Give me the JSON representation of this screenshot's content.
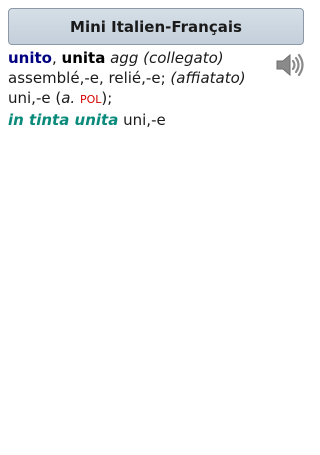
{
  "header": {
    "title": "Mini Italien-Français"
  },
  "entry": {
    "headword": "unito",
    "separator": ", ",
    "feminine": "unita",
    "pos": "agg",
    "sense1_note": "(collegato)",
    "sense1_translation": "assemblé,-e, relié,-e;",
    "sense2_note": "(affiatato)",
    "sense2_translation": "uni,-e (",
    "sense2_abbr": "a.",
    "sense2_domain": "POL",
    "sense2_close": ");",
    "phrase": "in tinta unita",
    "phrase_translation": "uni,-e"
  },
  "icons": {
    "speaker": "speaker-icon"
  },
  "colors": {
    "headword": "#000080",
    "phrase": "#0a8a7a",
    "domain": "#d40000"
  }
}
